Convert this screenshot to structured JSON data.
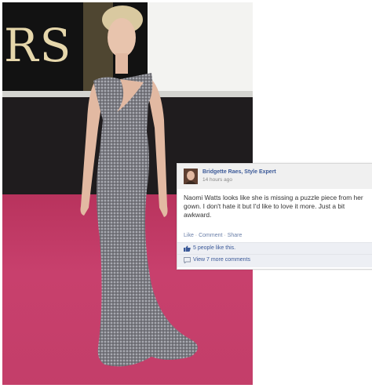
{
  "photo": {
    "backdrop_text": "RS",
    "icons": [
      "dress-figure"
    ]
  },
  "fb_post": {
    "author": "Bridgette Raes, Style Expert",
    "timestamp": "14 hours ago",
    "body": "Naomi Watts looks like she is missing a puzzle piece from her gown. I don't hate it but I'd like to love it more. Just a bit awkward.",
    "actions": {
      "like": "Like",
      "comment": "Comment",
      "share": "Share",
      "separator": "·"
    },
    "likes_text": "5 people like this.",
    "comments_text": "View 7 more comments",
    "colors": {
      "link": "#3b5998",
      "row_bg": "#edeff4"
    }
  }
}
